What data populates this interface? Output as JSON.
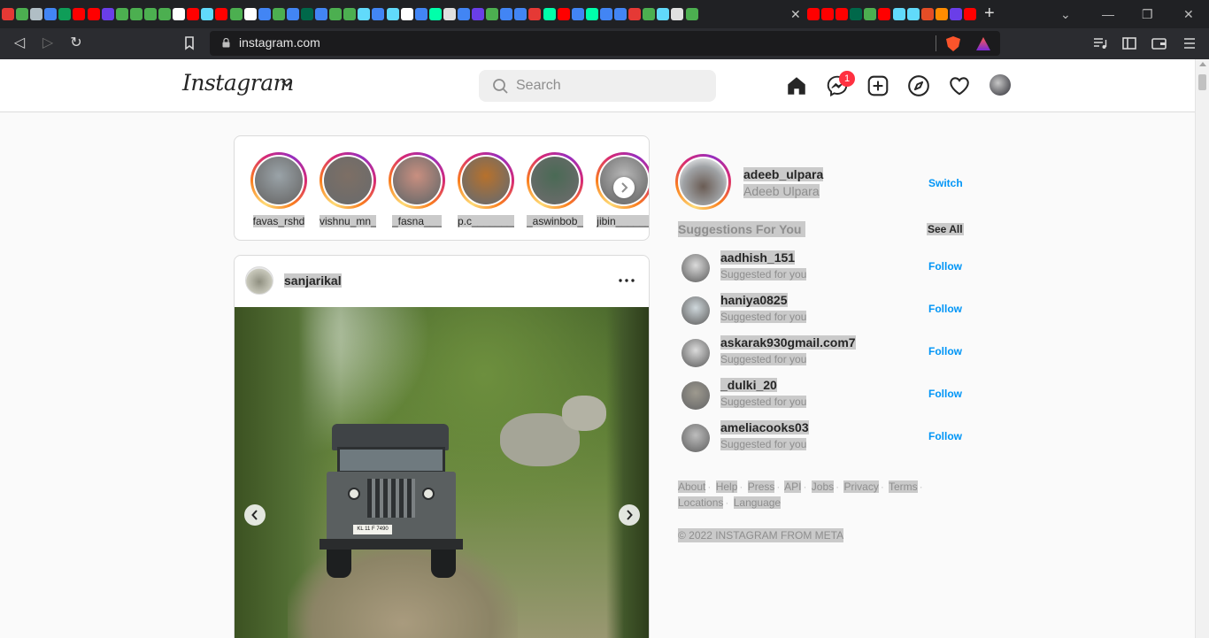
{
  "browser": {
    "url": "instagram.com",
    "tab_favicon_colors": [
      "#e53935",
      "#4caf50",
      "#b0bec5",
      "#4285f4",
      "#0f9d58",
      "#ff0000",
      "#ff0000",
      "#6a3ee8",
      "#4caf50",
      "#4caf50",
      "#4caf50",
      "#4caf50",
      "#ffffff",
      "#ff0000",
      "#61dafb",
      "#ff0000",
      "#4caf50",
      "#ffffff",
      "#4285f4",
      "#4caf50",
      "#4285f4",
      "#00684a",
      "#4285f4",
      "#4caf50",
      "#4caf50",
      "#61dafb",
      "#4285f4",
      "#61dafb",
      "#ffffff",
      "#4285f4",
      "#00ffaa",
      "#e0e0e0",
      "#4285f4",
      "#6a3ee8",
      "#4caf50",
      "#4285f4",
      "#4285f4",
      "#e53935",
      "#00ffaa",
      "#ff0000",
      "#4285f4",
      "#00ffaa",
      "#4285f4",
      "#4285f4",
      "#e53935",
      "#4caf50",
      "#61dafb",
      "#e0e0e0",
      "#4caf50"
    ],
    "after_close_favicon_colors": [
      "#ff0000",
      "#ff0000",
      "#ff0000",
      "#00684a",
      "#4caf50",
      "#ff0000",
      "#61dafb",
      "#61dafb",
      "#e44d26",
      "#ff8c00",
      "#6a3ee8",
      "#ff0000"
    ]
  },
  "header": {
    "logo_text": "Instagram",
    "search_placeholder": "Search",
    "messages_badge": "1",
    "icons": [
      "home-icon",
      "messenger-icon",
      "new-post-icon",
      "explore-icon",
      "activity-heart-icon",
      "profile-avatar"
    ]
  },
  "stories": [
    {
      "username": "favas_rshd",
      "pic_color": "#9aa3a8"
    },
    {
      "username": "vishnu_mn_",
      "pic_color": "#7d6f65"
    },
    {
      "username": "_fasna___",
      "pic_color": "#c98f80"
    },
    {
      "username": "p.c________",
      "pic_color": "#b7712c"
    },
    {
      "username": "_aswinbob__",
      "pic_color": "#4a6a55"
    },
    {
      "username": "jibin______",
      "pic_color": "#b9b9b9"
    }
  ],
  "post": {
    "username": "sanjarikal",
    "jeep_plate": "KL 11 F 7490"
  },
  "profile": {
    "username": "adeeb_ulpara",
    "full_name": "Adeeb Ulpara",
    "switch_label": "Switch"
  },
  "suggestions": {
    "title": "Suggestions For You",
    "see_all_label": "See All",
    "follow_label": "Follow",
    "items": [
      {
        "username": "aadhish_151",
        "subtitle": "Suggested for you",
        "avatar_color": "#dbdbdb"
      },
      {
        "username": "haniya0825",
        "subtitle": "Suggested for you",
        "avatar_color": "#cfd8dc"
      },
      {
        "username": "askarak930gmail.com7",
        "subtitle": "Suggested for you",
        "avatar_color": "#dbdbdb"
      },
      {
        "username": "_dulki_20",
        "subtitle": "Suggested for you",
        "avatar_color": "#9e9a8f"
      },
      {
        "username": "ameliacooks03",
        "subtitle": "Suggested for you",
        "avatar_color": "#bdbdbd"
      }
    ]
  },
  "footer": {
    "links": [
      "About",
      "Help",
      "Press",
      "API",
      "Jobs",
      "Privacy",
      "Terms",
      "Locations",
      "Language"
    ],
    "copyright": "© 2022 INSTAGRAM FROM META"
  },
  "colors": {
    "accent_blue": "#0095f6",
    "badge_red": "#ff3040",
    "text_primary": "#262626",
    "text_secondary": "#8e8e8e"
  }
}
